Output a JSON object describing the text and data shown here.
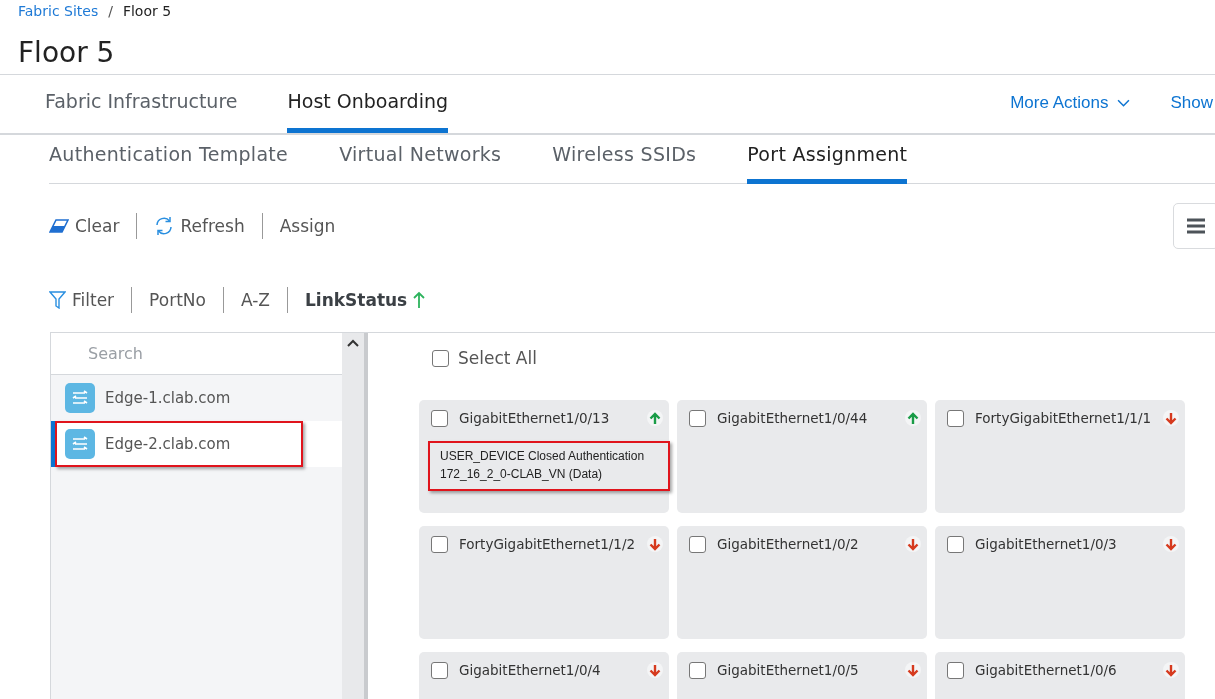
{
  "breadcrumb_separator": "/",
  "breadcrumb": [
    {
      "label": "Fabric Sites",
      "link": true
    },
    {
      "label": "Floor 5",
      "link": false
    }
  ],
  "title": "Floor 5",
  "tabs": [
    {
      "label": "Fabric Infrastructure",
      "selected": false
    },
    {
      "label": "Host Onboarding",
      "selected": true
    }
  ],
  "header_actions": [
    {
      "label": "More Actions",
      "dropdown": true
    },
    {
      "label": "Show",
      "dropdown": false
    }
  ],
  "subtabs": [
    {
      "label": "Authentication Template",
      "selected": false
    },
    {
      "label": "Virtual Networks",
      "selected": false
    },
    {
      "label": "Wireless SSIDs",
      "selected": false
    },
    {
      "label": "Port Assignment",
      "selected": true
    }
  ],
  "toolbar": [
    {
      "kind": "clear",
      "label": "Clear"
    },
    {
      "kind": "refresh",
      "label": "Refresh"
    },
    {
      "kind": "plain",
      "label": "Assign"
    }
  ],
  "sort_bar": [
    {
      "kind": "filter",
      "label": "Filter",
      "active": false
    },
    {
      "kind": "plain",
      "label": "PortNo",
      "active": false
    },
    {
      "kind": "plain",
      "label": "A-Z",
      "active": false
    },
    {
      "kind": "sort-up",
      "label": "LinkStatus",
      "active": true
    }
  ],
  "device_search": {
    "placeholder": "Search"
  },
  "devices": [
    {
      "name": "Edge-1.clab.com",
      "selected": false,
      "highlighted": false
    },
    {
      "name": "Edge-2.clab.com",
      "selected": true,
      "highlighted": true
    }
  ],
  "select_all": {
    "label": "Select All",
    "checked": false
  },
  "ports": [
    {
      "name": "GigabitEthernet1/0/13",
      "checked": false,
      "link_up": true,
      "assignment": "USER_DEVICE Closed Authentication\n172_16_2_0-CLAB_VN (Data)",
      "highlighted": true
    },
    {
      "name": "GigabitEthernet1/0/44",
      "checked": false,
      "link_up": true
    },
    {
      "name": "FortyGigabitEthernet1/1/1",
      "checked": false,
      "link_up": false
    },
    {
      "name": "FortyGigabitEthernet1/1/2",
      "checked": false,
      "link_up": false
    },
    {
      "name": "GigabitEthernet1/0/2",
      "checked": false,
      "link_up": false
    },
    {
      "name": "GigabitEthernet1/0/3",
      "checked": false,
      "link_up": false
    },
    {
      "name": "GigabitEthernet1/0/4",
      "checked": false,
      "link_up": false
    },
    {
      "name": "GigabitEthernet1/0/5",
      "checked": false,
      "link_up": false
    },
    {
      "name": "GigabitEthernet1/0/6",
      "checked": false,
      "link_up": false
    }
  ]
}
